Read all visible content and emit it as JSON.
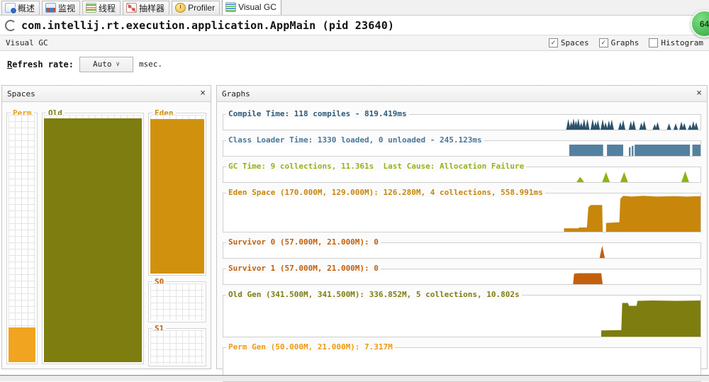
{
  "tabs": [
    {
      "id": "overview",
      "label": "概述",
      "icon": "overview-icon",
      "selected": false
    },
    {
      "id": "monitor",
      "label": "监视",
      "icon": "monitor-icon",
      "selected": false
    },
    {
      "id": "threads",
      "label": "线程",
      "icon": "threads-icon",
      "selected": false
    },
    {
      "id": "sampler",
      "label": "抽样器",
      "icon": "sampler-icon",
      "selected": false
    },
    {
      "id": "profiler",
      "label": "Profiler",
      "icon": "profiler-icon",
      "selected": false
    },
    {
      "id": "visualgc",
      "label": "Visual GC",
      "icon": "visualgc-icon",
      "selected": true
    }
  ],
  "badge": {
    "text": "64"
  },
  "title": "com.intellij.rt.execution.application.AppMain (pid 23640)",
  "toolbar": {
    "label": "Visual GC",
    "checkboxes": [
      {
        "id": "spaces",
        "label": "Spaces",
        "checked": true
      },
      {
        "id": "graphs",
        "label": "Graphs",
        "checked": true
      },
      {
        "id": "histogram",
        "label": "Histogram",
        "checked": false
      }
    ]
  },
  "refresh": {
    "mnemonic": "R",
    "label_rest": "efresh rate:",
    "value": "Auto",
    "unit": "msec."
  },
  "spaces_panel": {
    "title": "Spaces",
    "close_label": "×",
    "groups": [
      {
        "id": "perm",
        "label": "Perm",
        "label_color": "#ef9f16",
        "fill_color": "#f0a41f",
        "fill_pct": 14,
        "column": "left"
      },
      {
        "id": "old",
        "label": "Old",
        "label_color": "#7e7d10",
        "fill_color": "#7e7d10",
        "fill_pct": 98.5,
        "column": "mid"
      },
      {
        "id": "eden",
        "label": "Eden",
        "label_color": "#cf8f0a",
        "fill_color": "#d0920e",
        "fill_pct": 97.5,
        "column": "right"
      },
      {
        "id": "s0",
        "label": "S0",
        "label_color": "#c2600d",
        "fill_color": "#c2600d",
        "fill_pct": 0,
        "column": "right"
      },
      {
        "id": "s1",
        "label": "S1",
        "label_color": "#c2600d",
        "fill_color": "#c2600d",
        "fill_pct": 0,
        "column": "right"
      }
    ]
  },
  "graphs_panel": {
    "title": "Graphs",
    "close_label": "×",
    "rows": [
      {
        "id": "compile",
        "label": "Compile Time: 118 compiles - 819.419ms",
        "color": "#2d5a77",
        "fill": "#2b536d",
        "shape": {
          "type": "spikes",
          "default_w": 0.45,
          "points": [
            [
              72.3,
              72
            ],
            [
              72.9,
              55
            ],
            [
              73.4,
              76
            ],
            [
              73.9,
              62
            ],
            [
              74.4,
              76
            ],
            [
              75.0,
              50
            ],
            [
              75.6,
              74
            ],
            [
              76.3,
              70
            ],
            [
              77.4,
              72
            ],
            [
              78.0,
              55
            ],
            [
              78.5,
              65
            ],
            [
              79.5,
              70
            ],
            [
              80.1,
              50
            ],
            [
              80.8,
              62
            ],
            [
              81.4,
              68
            ],
            [
              83.2,
              52
            ],
            [
              83.8,
              66
            ],
            [
              85.4,
              58
            ],
            [
              86.0,
              64
            ],
            [
              87.6,
              48
            ],
            [
              88.2,
              60
            ],
            [
              90.4,
              38
            ],
            [
              91.0,
              52
            ],
            [
              93.4,
              42
            ],
            [
              94.8,
              42
            ],
            [
              96.0,
              55
            ],
            [
              96.6,
              45
            ],
            [
              97.8,
              35
            ],
            [
              98.5,
              58
            ],
            [
              99.1,
              50
            ]
          ]
        }
      },
      {
        "id": "classloader",
        "label": "Class Loader Time: 1330 loaded, 0 unloaded - 245.123ms",
        "color": "#4a7799",
        "fill": "#54809f",
        "shape": {
          "type": "bars",
          "bars": [
            [
              72.5,
              7.1,
              76
            ],
            [
              80.4,
              3.4,
              76
            ],
            [
              85.0,
              0.35,
              58
            ],
            [
              85.6,
              0.35,
              68
            ],
            [
              86.2,
              11.6,
              76
            ],
            [
              98.3,
              1.7,
              76
            ]
          ]
        }
      },
      {
        "id": "gc",
        "label": "GC Time: 9 collections, 11.361s  Last Cause: Allocation Failure",
        "color": "#93b31a",
        "fill": "#8fb412",
        "shape": {
          "type": "spikes",
          "default_w": 0.8,
          "points": [
            [
              74.8,
              36
            ],
            [
              80.2,
              68
            ],
            [
              84.0,
              68
            ],
            [
              96.8,
              74
            ]
          ]
        }
      },
      {
        "id": "eden",
        "label": "Eden Space (170.000M, 129.000M): 126.280M, 4 collections, 558.991ms",
        "color": "#c8860b",
        "fill": "#c8860b",
        "shape": {
          "type": "polygon",
          "points": [
            [
              71.4,
              0
            ],
            [
              71.4,
              9
            ],
            [
              74.5,
              9
            ],
            [
              74.5,
              11
            ],
            [
              76.2,
              11
            ],
            [
              76.5,
              64
            ],
            [
              77.0,
              70
            ],
            [
              79.4,
              70
            ],
            [
              79.5,
              0
            ],
            [
              80.2,
              0
            ],
            [
              80.2,
              23
            ],
            [
              83.0,
              25
            ],
            [
              83.2,
              86
            ],
            [
              83.8,
              94
            ],
            [
              85.5,
              92
            ],
            [
              88.0,
              94
            ],
            [
              91.0,
              92
            ],
            [
              94.5,
              93
            ],
            [
              97.0,
              92
            ],
            [
              100,
              93
            ],
            [
              100,
              0
            ]
          ]
        }
      },
      {
        "id": "s0",
        "label": "Survivor 0 (57.000M, 21.000M): 0",
        "color": "#c2600d",
        "fill": "#c2600d",
        "shape": {
          "type": "spikes",
          "default_w": 0.55,
          "points": [
            [
              79.4,
              82
            ]
          ]
        }
      },
      {
        "id": "s1",
        "label": "Survivor 1 (57.000M, 21.000M): 0",
        "color": "#c2600d",
        "fill": "#c2600d",
        "shape": {
          "type": "polygon",
          "points": [
            [
              73.3,
              0
            ],
            [
              73.5,
              70
            ],
            [
              74.3,
              74
            ],
            [
              79.2,
              74
            ],
            [
              79.5,
              0
            ]
          ]
        }
      },
      {
        "id": "old",
        "label": "Old Gen (341.500M, 341.500M): 336.852M, 5 collections, 10.802s",
        "color": "#7e7d10",
        "fill": "#7e7d10",
        "shape": {
          "type": "polygon",
          "points": [
            [
              79.2,
              0
            ],
            [
              79.2,
              15
            ],
            [
              83.4,
              16
            ],
            [
              83.6,
              82
            ],
            [
              84.8,
              82
            ],
            [
              85.0,
              75
            ],
            [
              86.6,
              75
            ],
            [
              86.8,
              87
            ],
            [
              90.0,
              88
            ],
            [
              95.0,
              87
            ],
            [
              100,
              88
            ],
            [
              100,
              0
            ]
          ]
        }
      },
      {
        "id": "perm",
        "label": "Perm Gen (50.000M, 21.000M): 7.317M",
        "color": "#ef9a10",
        "fill": "#f0a41f",
        "shape": {
          "type": "polygon",
          "points": [
            [
              71.8,
              0
            ],
            [
              71.9,
              10
            ],
            [
              73.0,
              13
            ],
            [
              80.0,
              13
            ],
            [
              87.0,
              12
            ],
            [
              94.0,
              13
            ],
            [
              100,
              13
            ],
            [
              100,
              0
            ]
          ]
        }
      }
    ]
  }
}
